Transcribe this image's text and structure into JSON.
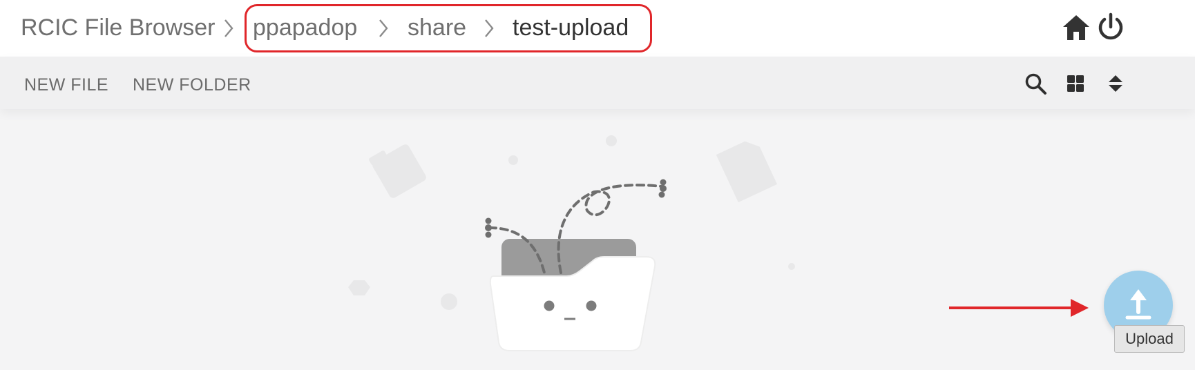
{
  "header": {
    "app_title": "RCIC File Browser",
    "breadcrumbs": [
      "ppapadop",
      "share",
      "test-upload"
    ],
    "home_icon": "home-icon",
    "logout_icon": "power-icon"
  },
  "toolbar": {
    "new_file_label": "NEW FILE",
    "new_folder_label": "NEW FOLDER",
    "search_icon": "search-icon",
    "view_icon": "grid-view-icon",
    "sort_icon": "sort-icon"
  },
  "upload": {
    "tooltip": "Upload",
    "icon": "upload-icon"
  },
  "colors": {
    "annotation_red": "#e0262a",
    "fab_blue": "#9ecfeb"
  }
}
